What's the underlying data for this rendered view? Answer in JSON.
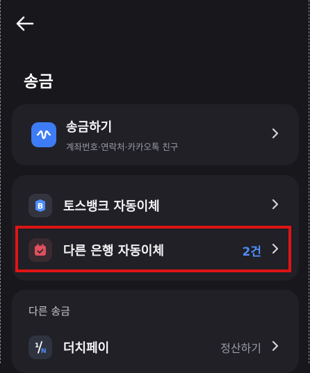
{
  "header": {
    "back_icon": "arrow-left-icon",
    "title": "송금"
  },
  "send": {
    "icon": "toss-send-icon",
    "label": "송금하기",
    "sub": "계좌번호·연락처·카카오톡 친구",
    "accent": "#3d7cf5"
  },
  "auto_transfer": {
    "items": [
      {
        "icon": "toss-bank-b-icon",
        "label": "토스뱅크 자동이체"
      },
      {
        "icon": "calendar-check-icon",
        "label": "다른 은행 자동이체",
        "count": "2건",
        "count_color": "#4f8df9"
      }
    ]
  },
  "other_send": {
    "section_label": "다른 송금",
    "items": [
      {
        "icon": "touch-pay-icon",
        "label": "더치페이",
        "action": "정산하기"
      }
    ]
  },
  "highlight_color": "#e01414"
}
